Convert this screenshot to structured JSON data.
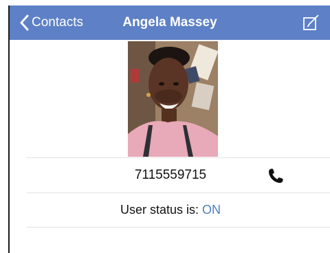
{
  "navbar": {
    "back_label": "Contacts",
    "title": "Angela Massey",
    "edit_icon": "compose-icon",
    "back_icon": "chevron-left-icon"
  },
  "contact": {
    "phone": "7115559715",
    "phone_icon": "phone-icon",
    "status_label": "User status is:",
    "status_value": "ON"
  },
  "colors": {
    "navbar_bg": "#5d80c6",
    "status_value": "#4a7fc1"
  }
}
